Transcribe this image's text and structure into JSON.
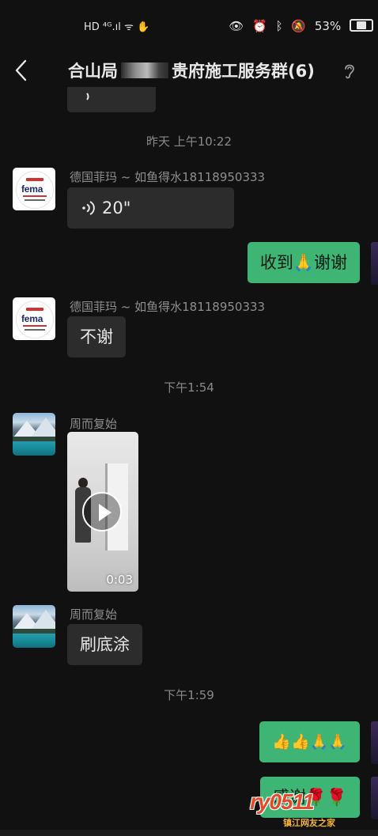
{
  "status_bar": {
    "left_icons": "HD ⁴ᴳ.ıl ᯤ ✋",
    "battery_percent": 53,
    "battery_label": "53%"
  },
  "header": {
    "title_prefix": "合山局",
    "title_suffix": "贵府施工服务群(6)"
  },
  "messages": {
    "time1": "昨天 上午10:22",
    "msg1_sender": "德国菲玛 ~ 如鱼得水18118950333",
    "msg1_voice": "20\"",
    "msg2_text_prefix": "收到",
    "msg2_emoji": "🙏",
    "msg2_text_suffix": "谢谢",
    "msg3_sender": "德国菲玛 ~ 如鱼得水18118950333",
    "msg3_text": "不谢",
    "time2": "下午1:54",
    "msg4_sender": "周而复始",
    "msg4_video_duration": "0:03",
    "msg5_sender": "周而复始",
    "msg5_text": "刷底涂",
    "time3": "下午1:59",
    "msg6_emojis": "👍👍🙏🙏",
    "msg7_text": "感谢",
    "msg7_emojis": "🌹🌹"
  },
  "avatars": {
    "fema_brand": "fema"
  },
  "watermark": {
    "logo": "ry0511",
    "sub": "镇江网友之家"
  },
  "colors": {
    "background": "#111111",
    "incoming_bubble": "#2c2c2c",
    "outgoing_bubble": "#3eb575",
    "timestamp": "#8a8a8a"
  }
}
